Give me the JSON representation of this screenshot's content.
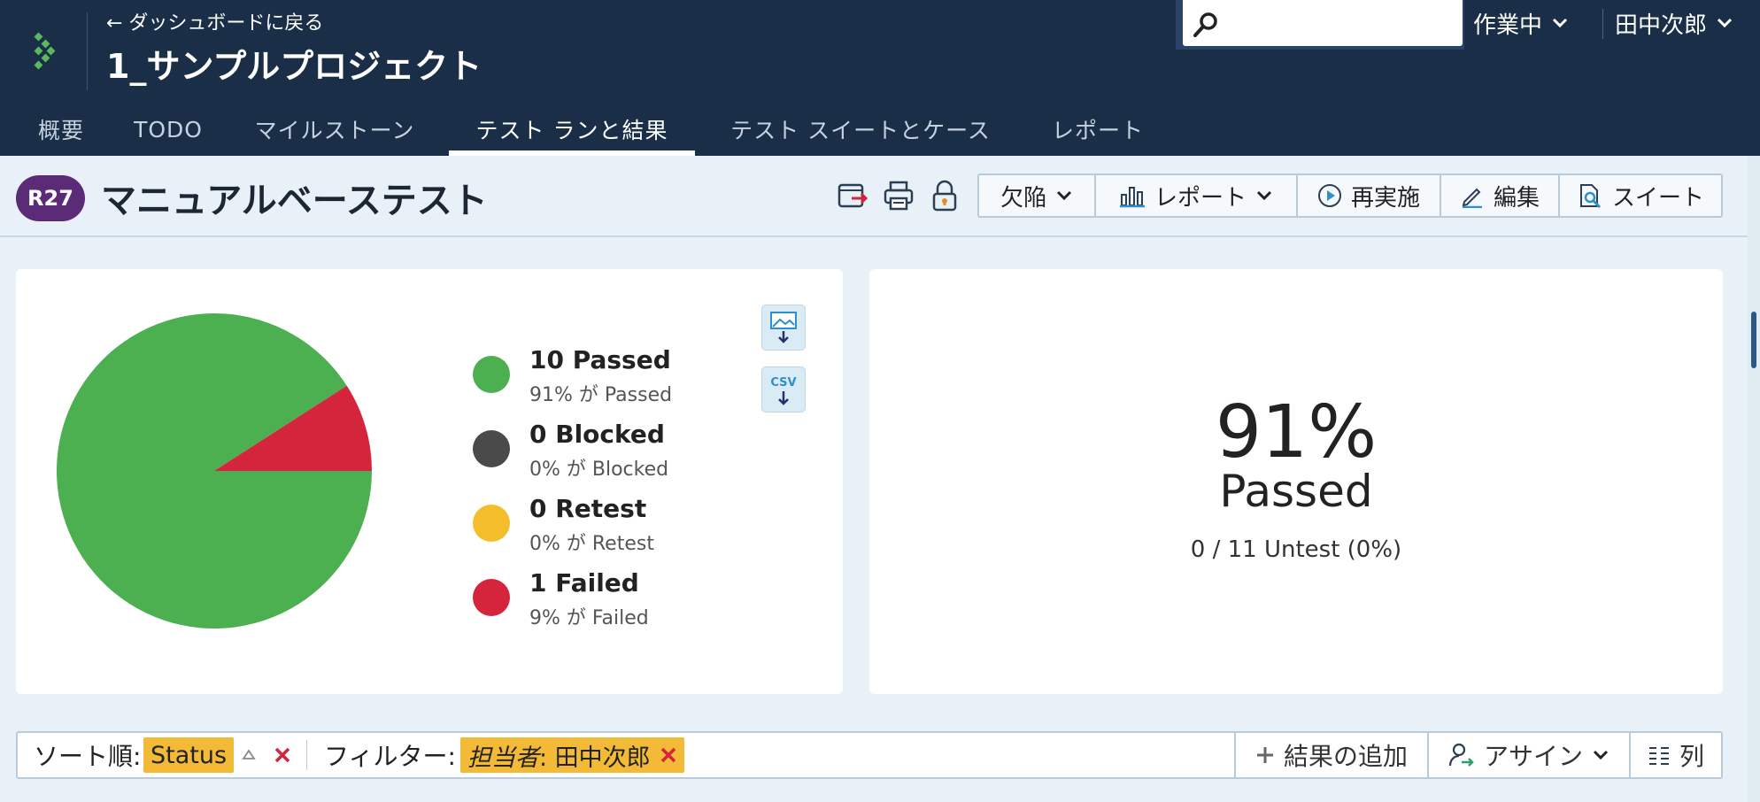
{
  "header": {
    "back_link": "← ダッシュボードに戻る",
    "project_title": "1_サンプルプロジェクト",
    "search": {
      "placeholder": "",
      "value": ""
    },
    "status_dropdown": "作業中",
    "user_dropdown": "田中次郎",
    "colors": {
      "bg": "#1a2e48",
      "logo": "#5cb85c"
    }
  },
  "tabs": [
    {
      "label": "概要",
      "active": false
    },
    {
      "label": "TODO",
      "active": false
    },
    {
      "label": "マイルストーン",
      "active": false
    },
    {
      "label": "テスト ランと結果",
      "active": true
    },
    {
      "label": "テスト スイートとケース",
      "active": false
    },
    {
      "label": "レポート",
      "active": false
    }
  ],
  "run": {
    "badge": "R27",
    "title": "マニュアルベーステスト",
    "icons": [
      "export-icon",
      "print-icon",
      "lock-icon"
    ],
    "buttons": [
      {
        "label": "欠陥",
        "icon": "chevron-down-icon"
      },
      {
        "label": "レポート",
        "icon": "bar-chart-icon"
      },
      {
        "label": "再実施",
        "icon": "play-icon"
      },
      {
        "label": "編集",
        "icon": "pencil-icon"
      },
      {
        "label": "スイート",
        "icon": "document-search-icon"
      }
    ]
  },
  "chart_data": {
    "type": "pie",
    "categories": [
      "Passed",
      "Blocked",
      "Retest",
      "Failed"
    ],
    "values": [
      10,
      0,
      0,
      1
    ],
    "colors": [
      "#4caf50",
      "#4a4a4a",
      "#f4bd2a",
      "#d5253c"
    ]
  },
  "legend": [
    {
      "title": "10 Passed",
      "sub": "91% が Passed",
      "color": "#4caf50"
    },
    {
      "title": "0 Blocked",
      "sub": "0% が Blocked",
      "color": "#4a4a4a"
    },
    {
      "title": "0 Retest",
      "sub": "0% が Retest",
      "color": "#f4bd2a"
    },
    {
      "title": "1 Failed",
      "sub": "9% が Failed",
      "color": "#d5253c"
    }
  ],
  "downloads": {
    "image_icon": "image-download-icon",
    "csv_label": "CSV"
  },
  "summary": {
    "percent": "91%",
    "label": "Passed",
    "untest": "0 / 11 Untest (0%)"
  },
  "filterbar": {
    "sort_label": "ソート順:",
    "sort_value": "Status",
    "filter_label": "フィルター:",
    "filter_key": "担当者",
    "filter_value": ": 田中次郎",
    "add_result": "結果の追加",
    "assign": "アサイン",
    "columns": "列"
  }
}
